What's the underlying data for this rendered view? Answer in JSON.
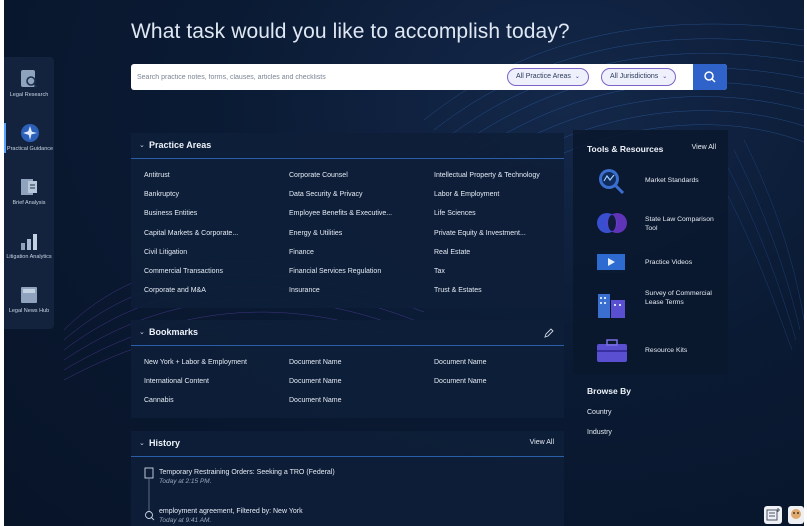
{
  "headline": "What task would you like to accomplish today?",
  "search": {
    "placeholder": "Search practice notes, forms, clauses, articles and checklists",
    "practice_areas_filter": "All Practice Areas",
    "jurisdictions_filter": "All Jurisdictions"
  },
  "rail": [
    {
      "label": "Legal Research",
      "icon": "legal-research-icon"
    },
    {
      "label": "Practical Guidance",
      "icon": "practical-guidance-icon"
    },
    {
      "label": "Brief Analysis",
      "icon": "brief-analysis-icon"
    },
    {
      "label": "Litigation Analytics",
      "icon": "litigation-analytics-icon"
    },
    {
      "label": "Legal News Hub",
      "icon": "legal-news-hub-icon"
    }
  ],
  "practice_areas": {
    "title": "Practice Areas",
    "columns": [
      [
        "Antitrust",
        "Bankruptcy",
        "Business Entities",
        "Capital Markets & Corporate...",
        "Civil Litigation",
        "Commercial Transactions",
        "Corporate and M&A"
      ],
      [
        "Corporate Counsel",
        "Data Security & Privacy",
        "Employee Benefits & Executive...",
        "Energy & Utilities",
        "Finance",
        "Financial Services Regulation",
        "Insurance"
      ],
      [
        "Intellectual Property & Technology",
        "Labor & Employment",
        "Life Sciences",
        "Private Equity & Investment...",
        "Real Estate",
        "Tax",
        "Trust & Estates"
      ]
    ]
  },
  "bookmarks": {
    "title": "Bookmarks",
    "columns": [
      [
        "New York + Labor & Employment",
        "International Content",
        "Cannabis"
      ],
      [
        "Document Name",
        "Document Name",
        "Document Name"
      ],
      [
        "Document Name",
        "Document Name"
      ]
    ]
  },
  "history": {
    "title": "History",
    "view_all": "View All",
    "items": [
      {
        "title": "Temporary Restraining Orders: Seeking a TRO (Federal)",
        "time": "Today at 2:15 PM.",
        "icon": "document-icon"
      },
      {
        "title": "employment agreement, Filtered by: New York",
        "time": "Today at 9:41 AM.",
        "icon": "search-icon"
      }
    ]
  },
  "tools": {
    "title": "Tools & Resources",
    "view_all": "View All",
    "items": [
      {
        "label": "Market Standards",
        "icon": "market-standards-icon"
      },
      {
        "label": "State Law Comparison Tool",
        "icon": "state-law-comparison-icon"
      },
      {
        "label": "Practice Videos",
        "icon": "practice-videos-icon"
      },
      {
        "label": "Survey of Commercial Lease Terms",
        "icon": "commercial-lease-survey-icon"
      },
      {
        "label": "Resource Kits",
        "icon": "resource-kits-icon"
      }
    ]
  },
  "browse": {
    "title": "Browse By",
    "links": [
      "Country",
      "Industry"
    ]
  },
  "colors": {
    "background": "#0a1a33",
    "panel": "#0e1e38",
    "accent": "#2f63c9",
    "pill_border": "#7b63c9"
  }
}
